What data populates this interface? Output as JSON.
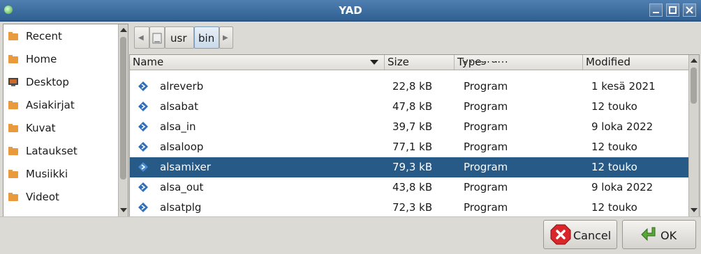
{
  "window": {
    "title": "YAD"
  },
  "pathbar": {
    "back_label": "◀",
    "segments": [
      "usr",
      "bin"
    ],
    "forward_label": "▶"
  },
  "sidebar": {
    "items": [
      {
        "label": "Recent",
        "icon": "recent-icon"
      },
      {
        "label": "Home",
        "icon": "home-icon"
      },
      {
        "label": "Desktop",
        "icon": "desktop-icon"
      },
      {
        "label": "Asiakirjat",
        "icon": "folder-icon"
      },
      {
        "label": "Kuvat",
        "icon": "folder-icon"
      },
      {
        "label": "Lataukset",
        "icon": "folder-icon"
      },
      {
        "label": "Musiikki",
        "icon": "folder-icon"
      },
      {
        "label": "Videot",
        "icon": "folder-icon"
      }
    ]
  },
  "file_list": {
    "columns": [
      "Name",
      "Size",
      "Type",
      "Modified"
    ],
    "partial_top": {
      "size": "",
      "type": "Program"
    },
    "rows": [
      {
        "name": "alreverb",
        "size": "22,8 kB",
        "type": "Program",
        "modified": "1 kesä 2021",
        "selected": false
      },
      {
        "name": "alsabat",
        "size": "47,8 kB",
        "type": "Program",
        "modified": "12 touko",
        "selected": false
      },
      {
        "name": "alsa_in",
        "size": "39,7 kB",
        "type": "Program",
        "modified": "9 loka 2022",
        "selected": false
      },
      {
        "name": "alsaloop",
        "size": "77,1 kB",
        "type": "Program",
        "modified": "12 touko",
        "selected": false
      },
      {
        "name": "alsamixer",
        "size": "79,3 kB",
        "type": "Program",
        "modified": "12 touko",
        "selected": true
      },
      {
        "name": "alsa_out",
        "size": "43,8 kB",
        "type": "Program",
        "modified": "9 loka 2022",
        "selected": false
      },
      {
        "name": "alsatplg",
        "size": "72,3 kB",
        "type": "Program",
        "modified": "12 touko",
        "selected": false
      }
    ]
  },
  "buttons": {
    "cancel_label": "Cancel",
    "ok_label": "OK"
  },
  "colors": {
    "selection": "#275a87",
    "titlebar": "#3d6c9f",
    "cancel_icon": "#d8262b",
    "ok_icon": "#5aa83a"
  }
}
